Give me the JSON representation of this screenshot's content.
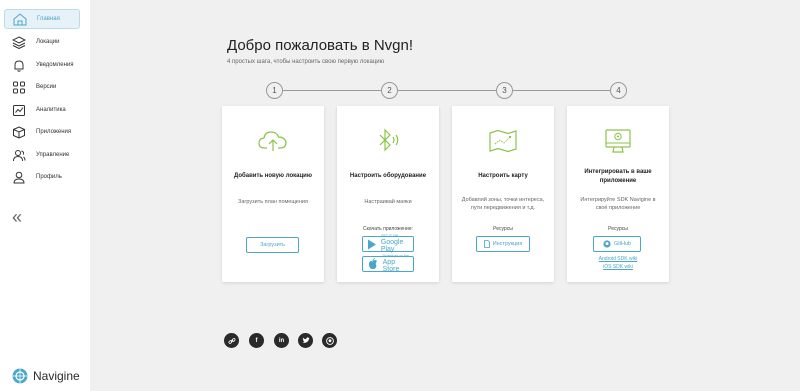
{
  "sidebar": {
    "items": [
      {
        "label": "Главная",
        "icon": "home-icon"
      },
      {
        "label": "Локации",
        "icon": "layers-icon"
      },
      {
        "label": "Уведомления",
        "icon": "bell-icon"
      },
      {
        "label": "Версии",
        "icon": "grid-icon"
      },
      {
        "label": "Аналитика",
        "icon": "analytics-icon"
      },
      {
        "label": "Приложения",
        "icon": "cube-icon"
      },
      {
        "label": "Управление",
        "icon": "users-icon"
      },
      {
        "label": "Профиль",
        "icon": "user-icon"
      }
    ],
    "collapse": "«",
    "logo_text": "Navigine"
  },
  "main": {
    "title": "Добро пожаловать в Nvgn!",
    "subtitle": "4 простых шага, чтобы настроить свою первую локацию",
    "steps": [
      "1",
      "2",
      "3",
      "4"
    ]
  },
  "cards": [
    {
      "title": "Добавить новую локацию",
      "desc": "Загрузить план помещения",
      "button": "Загрузить",
      "icon": "cloud-upload-icon"
    },
    {
      "title": "Настроить оборудование",
      "desc": "Настраивай маяки",
      "download_label": "Скачать приложение:",
      "google_small": "GET IT ON",
      "google_big": "Google Play",
      "apple_small": "Download on the",
      "apple_big": "App Store",
      "icon": "bluetooth-icon"
    },
    {
      "title": "Настроить карту",
      "desc_line1": "Добавляй зоны, точки интереса,",
      "desc_line2": "пути передвижения и т.д.",
      "resources_label": "Ресурсы",
      "button": "Инструкция",
      "icon": "map-icon"
    },
    {
      "title_line1": "Интегрировать в ваше",
      "title_line2": "приложение",
      "desc_line1": "Интегрируйте SDK Navigine в",
      "desc_line2": "своё приложение",
      "resources_label": "Ресурсы",
      "button": "GitHub",
      "link1": "Android SDK wiki",
      "link2": "iOS SDK wiki",
      "icon": "monitor-icon"
    }
  ],
  "social": [
    {
      "name": "link-icon",
      "glyph": "🔗"
    },
    {
      "name": "facebook-icon",
      "glyph": "f"
    },
    {
      "name": "linkedin-icon",
      "glyph": "in"
    },
    {
      "name": "twitter-icon",
      "glyph": "t"
    },
    {
      "name": "github-icon",
      "glyph": "◉"
    }
  ],
  "colors": {
    "accent": "#4aa7c9",
    "icon_green": "#8bc34a",
    "background": "#f0f0f0"
  }
}
